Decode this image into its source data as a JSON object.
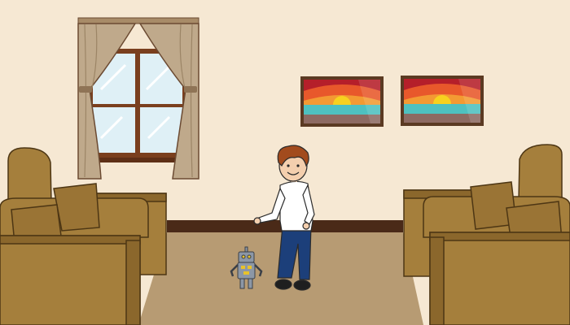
{
  "scene": {
    "name": "living-room",
    "colors": {
      "wall": "#f6e8d3",
      "floor": "#b79b73",
      "baseboard": "#4a2a18",
      "sofa": "#a57f3c",
      "sofa_dark": "#8b672c",
      "curtain": "#bfa98b",
      "window_frame": "#7a3f1e",
      "glass": "#dff0f6",
      "shirt": "#ffffff",
      "jeans": "#1c3f7a",
      "hair": "#a24b1d",
      "skin": "#f4cfae",
      "robot": "#8c97a6"
    },
    "sunset_palette": [
      "#b51f2a",
      "#e8582b",
      "#f39a33",
      "#f7d11f",
      "#4ec1c0",
      "#8d6a62"
    ]
  }
}
